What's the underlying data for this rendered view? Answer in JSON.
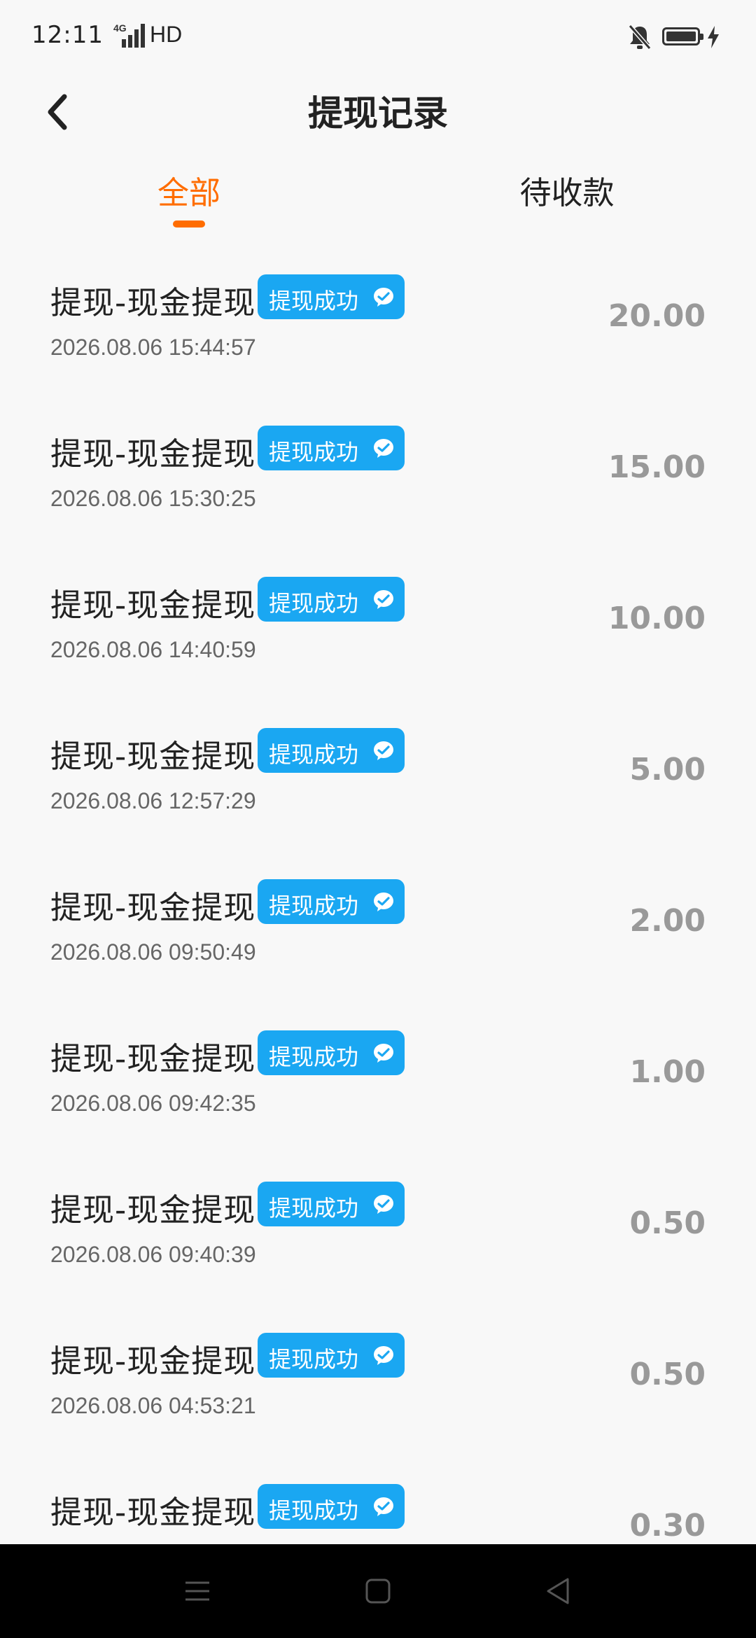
{
  "status_bar": {
    "time": "12:11",
    "network": "4G",
    "hd": "HD",
    "icons": [
      "mute-bell-icon",
      "battery-icon",
      "charging-bolt-icon"
    ]
  },
  "header": {
    "title": "提现记录",
    "back_icon": "chevron-left-icon"
  },
  "tabs": [
    {
      "label": "全部",
      "active": true
    },
    {
      "label": "待收款",
      "active": false
    }
  ],
  "colors": {
    "accent": "#ff6d00",
    "badge": "#1aa7f2",
    "amount": "#999999"
  },
  "records": [
    {
      "title": "提现-现金提现",
      "status": "提现成功",
      "icon": "wechat-icon",
      "time": "2026.08.06 15:44:57",
      "amount": "20.00"
    },
    {
      "title": "提现-现金提现",
      "status": "提现成功",
      "icon": "wechat-icon",
      "time": "2026.08.06 15:30:25",
      "amount": "15.00"
    },
    {
      "title": "提现-现金提现",
      "status": "提现成功",
      "icon": "wechat-icon",
      "time": "2026.08.06 14:40:59",
      "amount": "10.00"
    },
    {
      "title": "提现-现金提现",
      "status": "提现成功",
      "icon": "wechat-icon",
      "time": "2026.08.06 12:57:29",
      "amount": "5.00"
    },
    {
      "title": "提现-现金提现",
      "status": "提现成功",
      "icon": "wechat-icon",
      "time": "2026.08.06 09:50:49",
      "amount": "2.00"
    },
    {
      "title": "提现-现金提现",
      "status": "提现成功",
      "icon": "wechat-icon",
      "time": "2026.08.06 09:42:35",
      "amount": "1.00"
    },
    {
      "title": "提现-现金提现",
      "status": "提现成功",
      "icon": "wechat-icon",
      "time": "2026.08.06 09:40:39",
      "amount": "0.50"
    },
    {
      "title": "提现-现金提现",
      "status": "提现成功",
      "icon": "wechat-icon",
      "time": "2026.08.06 04:53:21",
      "amount": "0.50"
    },
    {
      "title": "提现-现金提现",
      "status": "提现成功",
      "icon": "wechat-icon",
      "time": "",
      "amount": "0.30"
    }
  ],
  "nav_bar": {
    "buttons": [
      "menu-icon",
      "home-icon",
      "back-triangle-icon"
    ]
  }
}
